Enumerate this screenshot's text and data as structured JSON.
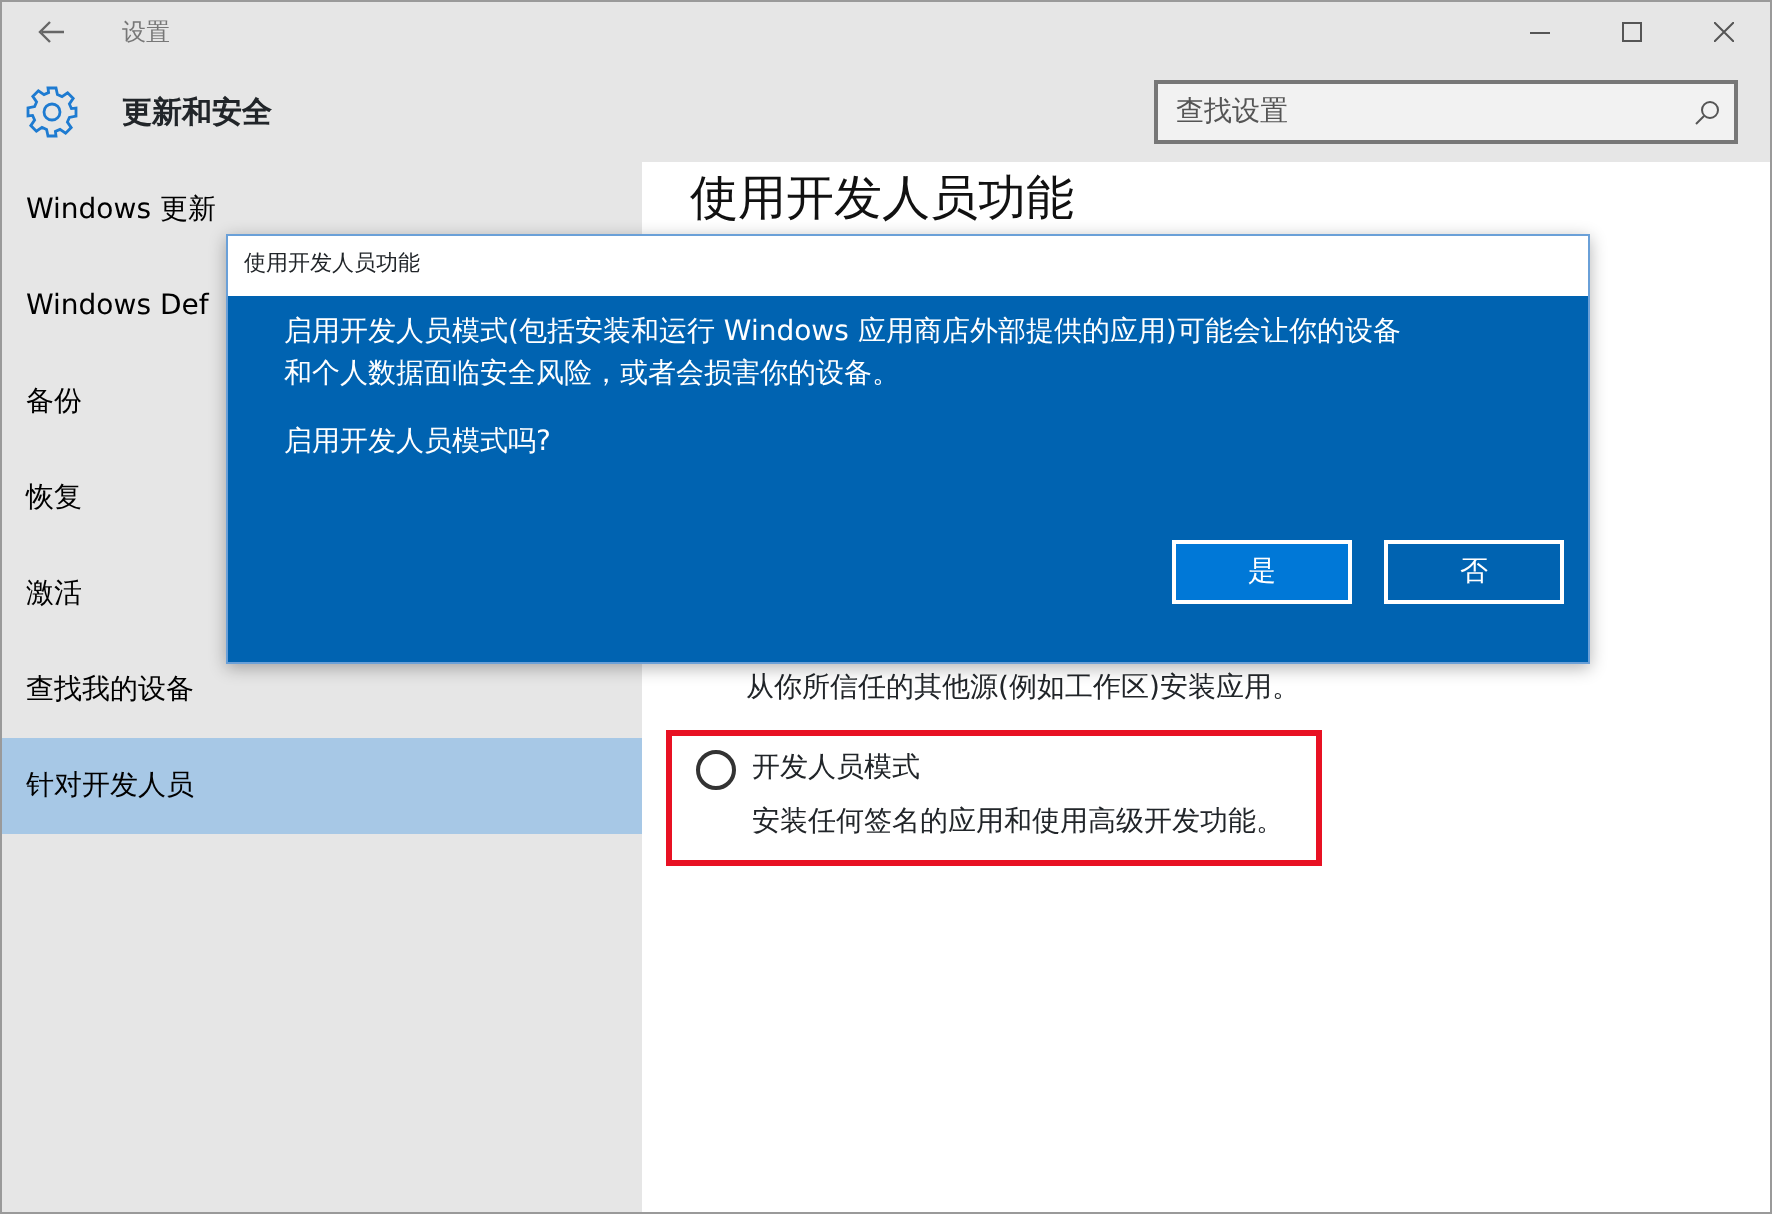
{
  "window": {
    "title": "设置"
  },
  "header": {
    "title": "更新和安全",
    "search": {
      "placeholder": "查找设置"
    }
  },
  "sidebar": {
    "items": [
      {
        "label": "Windows 更新",
        "selected": false
      },
      {
        "label": "Windows Def",
        "selected": false
      },
      {
        "label": "备份",
        "selected": false
      },
      {
        "label": "恢复",
        "selected": false
      },
      {
        "label": "激活",
        "selected": false
      },
      {
        "label": "查找我的设备",
        "selected": false
      },
      {
        "label": "针对开发人员",
        "selected": true
      }
    ]
  },
  "content": {
    "heading": "使用开发人员功能",
    "partial_text": "从你所信任的其他源(例如工作区)安装应用。",
    "options": [
      {
        "label": "开发人员模式",
        "description": "安装任何签名的应用和使用高级开发功能。",
        "selected": false,
        "highlighted": true
      }
    ]
  },
  "dialog": {
    "title": "使用开发人员功能",
    "message_lines": [
      "启用开发人员模式(包括安装和运行 Windows 应用商店外部提供的应用)可能会让你的设备",
      "和个人数据面临安全风险，或者会损害你的设备。"
    ],
    "question": "启用开发人员模式吗?",
    "buttons": [
      {
        "label": "是",
        "selected": true
      },
      {
        "label": "否",
        "selected": false
      }
    ]
  }
}
